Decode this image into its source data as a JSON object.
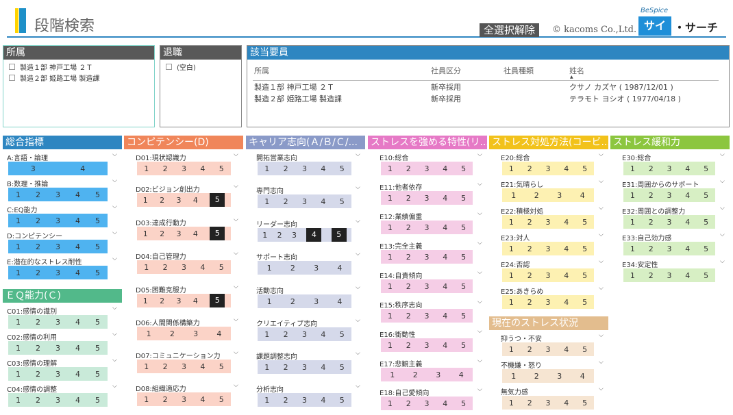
{
  "header": {
    "title": "段階検索",
    "clear_button": "全選択解除",
    "copyright": "© kacoms Co.,Ltd.",
    "logo_top": "BeSpice",
    "logo_main": "サイ",
    "logo_rest": "・サーチ"
  },
  "affiliation": {
    "title": "所属",
    "items": [
      "製造１部 神戸工場 ２Ｔ",
      "製造２部 姫路工場 製造課"
    ]
  },
  "retirement": {
    "title": "退職",
    "items": [
      "(空白)"
    ]
  },
  "members": {
    "title": "該当要員",
    "columns": [
      "所属",
      "社員区分",
      "社員種類",
      "姓名"
    ],
    "rows": [
      [
        "製造１部 神戸工場 ２Ｔ",
        "新卒採用",
        "",
        "クサノ カズヤ ( 1987/12/01 )"
      ],
      [
        "製造２部 姫路工場 製造課",
        "新卒採用",
        "",
        "テラモト ヨシオ ( 1977/04/18 )"
      ]
    ]
  },
  "sections": [
    {
      "title": "総合指標",
      "color": "#2e86c1",
      "strip": "#4fb3f0",
      "filters": [
        {
          "label": "A:言語・論理",
          "values": [
            "3",
            "4"
          ],
          "selected": []
        },
        {
          "label": "B:数理・推論",
          "values": [
            "1",
            "2",
            "3",
            "4",
            "5"
          ],
          "selected": []
        },
        {
          "label": "C:EQ能力",
          "values": [
            "1",
            "2",
            "3",
            "4",
            "5"
          ],
          "selected": []
        },
        {
          "label": "D:コンピテンシー",
          "values": [
            "1",
            "2",
            "3",
            "4",
            "5"
          ],
          "selected": []
        },
        {
          "label": "E:潜在的なストレス耐性",
          "values": [
            "1",
            "2",
            "3",
            "4",
            "5"
          ],
          "selected": []
        }
      ]
    },
    {
      "title": "ＥＱ能力(Ｃ)",
      "color": "#52b98a",
      "strip": "#c9ead9",
      "filters": [
        {
          "label": "C01:感情の識別",
          "values": [
            "1",
            "2",
            "3",
            "4",
            "5"
          ],
          "selected": []
        },
        {
          "label": "C02:感情の利用",
          "values": [
            "1",
            "2",
            "3",
            "4",
            "5"
          ],
          "selected": []
        },
        {
          "label": "C03:感情の理解",
          "values": [
            "1",
            "2",
            "3",
            "4",
            "5"
          ],
          "selected": []
        },
        {
          "label": "C04:感情の調整",
          "values": [
            "1",
            "2",
            "3",
            "4",
            "5"
          ],
          "selected": []
        }
      ]
    },
    {
      "title": "コンピテンシー(D)",
      "color": "#f0865a",
      "strip": "#fbd3c7",
      "filters": [
        {
          "label": "D01:現状認識力",
          "values": [
            "1",
            "2",
            "3",
            "4",
            "5"
          ],
          "selected": []
        },
        {
          "label": "D02:ビジョン創出力",
          "values": [
            "1",
            "2",
            "3",
            "4",
            "5"
          ],
          "selected": [
            "5"
          ]
        },
        {
          "label": "D03:達成行動力",
          "values": [
            "1",
            "2",
            "3",
            "4",
            "5"
          ],
          "selected": [
            "5"
          ]
        },
        {
          "label": "D04:自己管理力",
          "values": [
            "1",
            "2",
            "3",
            "4",
            "5"
          ],
          "selected": []
        },
        {
          "label": "D05:困難克服力",
          "values": [
            "1",
            "2",
            "3",
            "4",
            "5"
          ],
          "selected": [
            "5"
          ]
        },
        {
          "label": "D06:人間関係構築力",
          "values": [
            "1",
            "2",
            "3",
            "4"
          ],
          "selected": []
        },
        {
          "label": "D07:コミュニケーション力",
          "values": [
            "1",
            "2",
            "3",
            "4",
            "5"
          ],
          "selected": []
        },
        {
          "label": "D08:組織適応力",
          "values": [
            "1",
            "2",
            "3",
            "4",
            "5"
          ],
          "selected": []
        }
      ]
    },
    {
      "title": "キャリア志向(Ａ/Ｂ/Ｃ/...",
      "color": "#8a9ac8",
      "strip": "#d5d9ea",
      "filters": [
        {
          "label": "開拓営業志向",
          "values": [
            "1",
            "2",
            "3",
            "4",
            "5"
          ],
          "selected": []
        },
        {
          "label": "専門志向",
          "values": [
            "1",
            "2",
            "3",
            "4",
            "5"
          ],
          "selected": []
        },
        {
          "label": "リーダー志向",
          "values": [
            "1",
            "2",
            "3",
            "4",
            "5"
          ],
          "selected": [
            "4",
            "5"
          ]
        },
        {
          "label": "サポート志向",
          "values": [
            "1",
            "2",
            "3",
            "4"
          ],
          "selected": []
        },
        {
          "label": "活動志向",
          "values": [
            "1",
            "2",
            "3",
            "4"
          ],
          "selected": []
        },
        {
          "label": "クリエイティブ志向",
          "values": [
            "1",
            "2",
            "3",
            "4",
            "5"
          ],
          "selected": []
        },
        {
          "label": "課題調整志向",
          "values": [
            "1",
            "2",
            "3",
            "4",
            "5"
          ],
          "selected": []
        },
        {
          "label": "分析志向",
          "values": [
            "1",
            "2",
            "3",
            "4",
            "5"
          ],
          "selected": []
        }
      ]
    },
    {
      "title": "ストレスを強める特性(リ...",
      "color": "#e679c6",
      "strip": "#f5cde6",
      "filters": [
        {
          "label": "E10:総合",
          "values": [
            "1",
            "2",
            "3",
            "4",
            "5"
          ],
          "selected": []
        },
        {
          "label": "E11:他者依存",
          "values": [
            "1",
            "2",
            "3",
            "4",
            "5"
          ],
          "selected": []
        },
        {
          "label": "E12:業績偏重",
          "values": [
            "1",
            "2",
            "3",
            "4",
            "5"
          ],
          "selected": []
        },
        {
          "label": "E13:完全主義",
          "values": [
            "1",
            "2",
            "3",
            "4",
            "5"
          ],
          "selected": []
        },
        {
          "label": "E14:自責傾向",
          "values": [
            "1",
            "2",
            "3",
            "4",
            "5"
          ],
          "selected": []
        },
        {
          "label": "E15:秩序志向",
          "values": [
            "1",
            "2",
            "3",
            "4",
            "5"
          ],
          "selected": []
        },
        {
          "label": "E16:衝動性",
          "values": [
            "1",
            "2",
            "3",
            "4",
            "5"
          ],
          "selected": []
        },
        {
          "label": "E17:悲観主義",
          "values": [
            "1",
            "2",
            "3",
            "4"
          ],
          "selected": []
        },
        {
          "label": "E18:自己愛傾向",
          "values": [
            "1",
            "2",
            "3",
            "4",
            "5"
          ],
          "selected": []
        }
      ]
    },
    {
      "title": "ストレス対処方法(コービ...",
      "color": "#f2c21b",
      "strip": "#fdf1b2",
      "filters": [
        {
          "label": "E20:総合",
          "values": [
            "1",
            "2",
            "3",
            "4",
            "5"
          ],
          "selected": []
        },
        {
          "label": "E21:気晴らし",
          "values": [
            "1",
            "2",
            "3",
            "4"
          ],
          "selected": []
        },
        {
          "label": "E22:積極対処",
          "values": [
            "1",
            "2",
            "3",
            "4",
            "5"
          ],
          "selected": []
        },
        {
          "label": "E23:対人",
          "values": [
            "1",
            "2",
            "3",
            "4",
            "5"
          ],
          "selected": []
        },
        {
          "label": "E24:否認",
          "values": [
            "1",
            "2",
            "3",
            "4",
            "5"
          ],
          "selected": []
        },
        {
          "label": "E25:あきらめ",
          "values": [
            "1",
            "2",
            "3",
            "4",
            "5"
          ],
          "selected": []
        }
      ]
    },
    {
      "title": "現在のストレス状況",
      "color": "#e3bd8e",
      "strip": "#f6e5d2",
      "filters": [
        {
          "label": "抑うつ・不安",
          "values": [
            "1",
            "2",
            "3",
            "4",
            "5"
          ],
          "selected": []
        },
        {
          "label": "不機嫌・怒り",
          "values": [
            "1",
            "2",
            "3",
            "4"
          ],
          "selected": []
        },
        {
          "label": "無気力感",
          "values": [
            "1",
            "2",
            "3",
            "4",
            "5"
          ],
          "selected": []
        }
      ]
    },
    {
      "title": "ストレス緩和力",
      "color": "#8cc63f",
      "strip": "#d7efc4",
      "filters": [
        {
          "label": "E30:総合",
          "values": [
            "1",
            "2",
            "3",
            "4",
            "5"
          ],
          "selected": []
        },
        {
          "label": "E31:周囲からのサポート",
          "values": [
            "1",
            "2",
            "3",
            "4",
            "5"
          ],
          "selected": []
        },
        {
          "label": "E32:周囲との調整力",
          "values": [
            "1",
            "2",
            "3",
            "4",
            "5"
          ],
          "selected": []
        },
        {
          "label": "E33:自己効力感",
          "values": [
            "1",
            "2",
            "3",
            "4",
            "5"
          ],
          "selected": []
        },
        {
          "label": "E34:安定性",
          "values": [
            "1",
            "2",
            "3",
            "4",
            "5"
          ],
          "selected": []
        }
      ]
    }
  ]
}
